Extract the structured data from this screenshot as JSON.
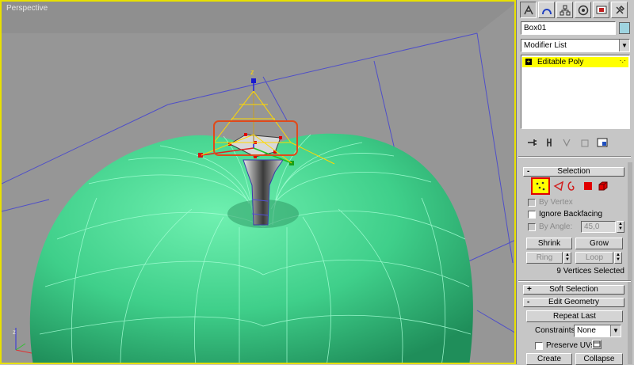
{
  "viewport": {
    "label": "Perspective",
    "gizmo_axis_label": "z"
  },
  "panel": {
    "tabs": [
      {
        "name": "create-tab-icon",
        "active": true
      },
      {
        "name": "modify-tab-icon",
        "active": false
      },
      {
        "name": "hierarchy-tab-icon",
        "active": false
      },
      {
        "name": "motion-tab-icon",
        "active": false
      },
      {
        "name": "display-tab-icon",
        "active": false
      },
      {
        "name": "utilities-tab-icon",
        "active": false
      }
    ],
    "object_name": "Box01",
    "object_color": "#9fd4e0",
    "modifier_list": "Modifier List",
    "stack": {
      "item_label": "Editable Poly",
      "item_sign": "+"
    },
    "selection": {
      "title": "Selection",
      "title_sign": "-",
      "by_vertex": "By Vertex",
      "ignore_backfacing": "Ignore Backfacing",
      "by_angle": "By Angle:",
      "angle_value": "45,0",
      "shrink": "Shrink",
      "grow": "Grow",
      "ring": "Ring",
      "loop": "Loop",
      "status": "9 Vertices Selected"
    },
    "soft_selection": {
      "title": "Soft Selection",
      "title_sign": "+"
    },
    "edit_geometry": {
      "title": "Edit Geometry",
      "title_sign": "-",
      "repeat_last": "Repeat Last",
      "constraints_label": "Constraints:",
      "constraints_value": "None",
      "preserve_uvs": "Preserve UVs",
      "create": "Create",
      "collapse": "Collapse"
    }
  },
  "colors": {
    "apple": "#3fcf8a",
    "highlight_yellow": "#ffff00",
    "selection_red": "#e00000",
    "viewport_border": "#e8e000"
  }
}
